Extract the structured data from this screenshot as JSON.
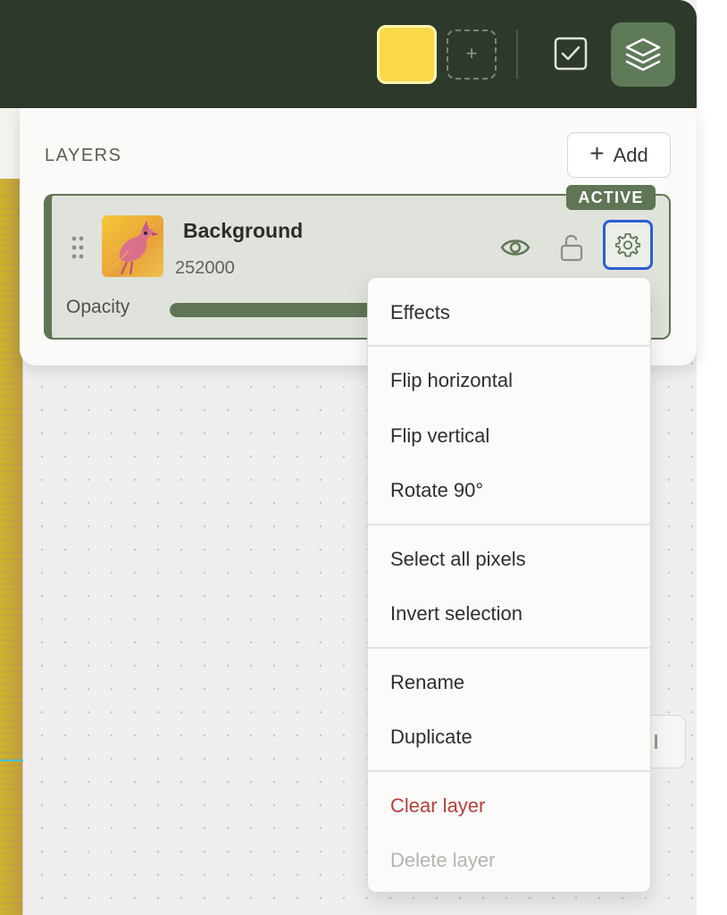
{
  "toolbar": {
    "swatch_color": "#fad949",
    "add_swatch_label": "+",
    "icons": [
      "check-square-icon",
      "layers-icon"
    ]
  },
  "layers_panel": {
    "title": "LAYERS",
    "add_button": {
      "icon": "+",
      "label": "Add"
    },
    "active_badge": "ACTIVE",
    "layer": {
      "name": "Background",
      "size": "252000",
      "opacity_label": "Opacity",
      "opacity_fraction": 0.72
    }
  },
  "context_menu": {
    "groups": [
      [
        "Effects"
      ],
      [
        "Flip horizontal",
        "Flip vertical",
        "Rotate 90°"
      ],
      [
        "Select all pixels",
        "Invert selection"
      ],
      [
        "Rename",
        "Duplicate"
      ],
      [
        "Clear layer",
        "Delete layer"
      ]
    ],
    "items": {
      "effects": "Effects",
      "flip_horizontal": "Flip horizontal",
      "flip_vertical": "Flip vertical",
      "rotate": "Rotate 90°",
      "select_all": "Select all pixels",
      "invert_selection": "Invert selection",
      "rename": "Rename",
      "duplicate": "Duplicate",
      "clear_layer": "Clear layer",
      "delete_layer": "Delete layer"
    }
  },
  "colors": {
    "topbar": "#2d3a2b",
    "accent": "#5f7556",
    "danger": "#b0413e",
    "focus": "#2d5fd0"
  }
}
